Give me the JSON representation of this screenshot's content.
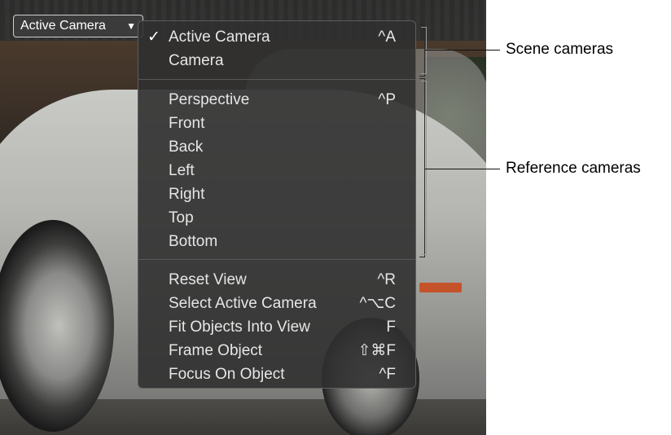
{
  "popup_button": {
    "label": "Active Camera",
    "arrow": "▼"
  },
  "menu": {
    "scene": [
      {
        "label": "Active Camera",
        "shortcut": "^A",
        "checked": true
      },
      {
        "label": "Camera",
        "shortcut": "",
        "checked": false
      }
    ],
    "reference": [
      {
        "label": "Perspective",
        "shortcut": "^P"
      },
      {
        "label": "Front",
        "shortcut": ""
      },
      {
        "label": "Back",
        "shortcut": ""
      },
      {
        "label": "Left",
        "shortcut": ""
      },
      {
        "label": "Right",
        "shortcut": ""
      },
      {
        "label": "Top",
        "shortcut": ""
      },
      {
        "label": "Bottom",
        "shortcut": ""
      }
    ],
    "actions": [
      {
        "label": "Reset View",
        "shortcut": "^R"
      },
      {
        "label": "Select Active Camera",
        "shortcut": "^⌥C"
      },
      {
        "label": "Fit Objects Into View",
        "shortcut": "F"
      },
      {
        "label": "Frame Object",
        "shortcut": "⇧⌘F"
      },
      {
        "label": "Focus On Object",
        "shortcut": "^F"
      }
    ],
    "check_mark": "✓"
  },
  "callouts": {
    "scene": "Scene cameras",
    "reference": "Reference cameras"
  }
}
